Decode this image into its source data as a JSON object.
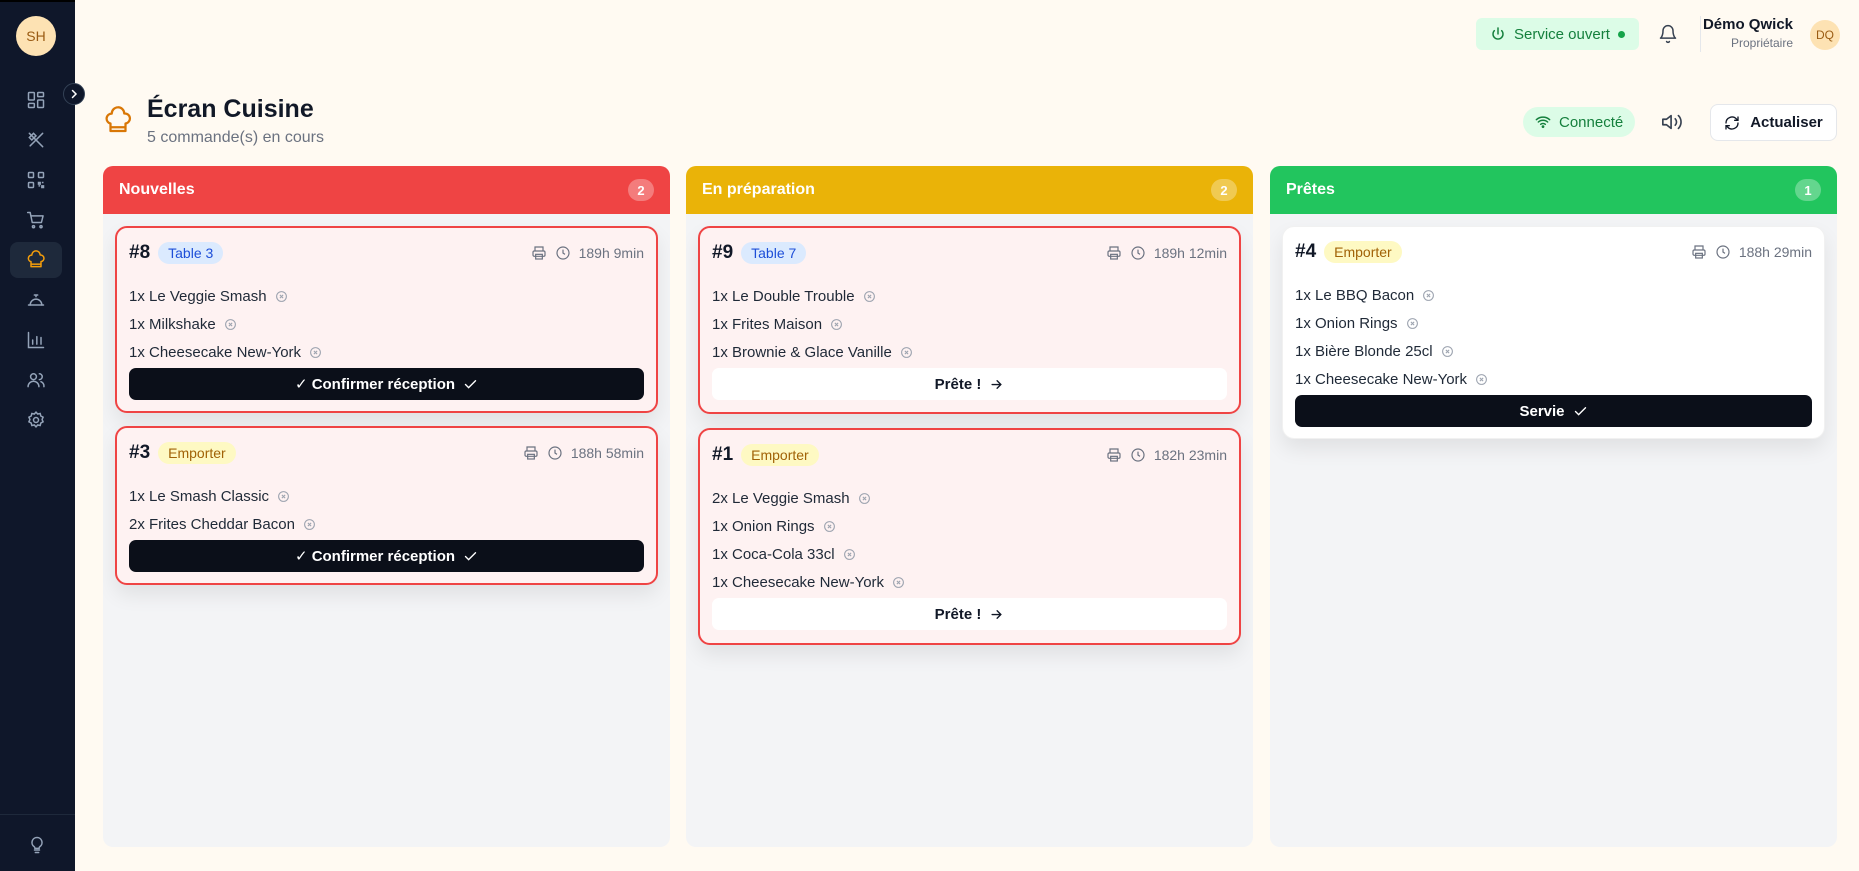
{
  "sidebar": {
    "avatar": "SH",
    "items": [
      {
        "icon": "dashboard-icon",
        "active": false
      },
      {
        "icon": "utensils-icon",
        "active": false
      },
      {
        "icon": "qr-code-icon",
        "active": false
      },
      {
        "icon": "cart-icon",
        "active": false
      },
      {
        "icon": "chef-hat-icon",
        "active": true
      },
      {
        "icon": "service-bell-icon",
        "active": false
      },
      {
        "icon": "bar-chart-icon",
        "active": false
      },
      {
        "icon": "users-icon",
        "active": false
      },
      {
        "icon": "settings-icon",
        "active": false
      }
    ]
  },
  "topbar": {
    "service_status": "Service ouvert",
    "user_name": "Démo Qwick",
    "user_role": "Propriétaire",
    "user_initials": "DQ"
  },
  "header": {
    "title": "Écran Cuisine",
    "subtitle": "5 commande(s) en cours",
    "connection": "Connecté",
    "refresh_label": "Actualiser"
  },
  "columns": {
    "new": {
      "title": "Nouvelles",
      "count": "2",
      "color": "#ef4444",
      "orders": [
        {
          "number": "#8",
          "tag": "Table 3",
          "time": "189h 9min",
          "items": [
            "1x Le Veggie Smash",
            "1x Milkshake",
            "1x Cheesecake New-York"
          ],
          "action": "✓ Confirmer réception"
        },
        {
          "number": "#3",
          "tag": "Emporter",
          "time": "188h 58min",
          "items": [
            "1x Le Smash Classic",
            "2x Frites Cheddar Bacon"
          ],
          "action": "✓ Confirmer réception"
        }
      ]
    },
    "prep": {
      "title": "En préparation",
      "count": "2",
      "color": "#eab308",
      "orders": [
        {
          "number": "#9",
          "tag": "Table 7",
          "time": "189h 12min",
          "items": [
            "1x Le Double Trouble",
            "1x Frites Maison",
            "1x Brownie & Glace Vanille"
          ],
          "action": "Prête !"
        },
        {
          "number": "#1",
          "tag": "Emporter",
          "time": "182h 23min",
          "items": [
            "2x Le Veggie Smash",
            "1x Onion Rings",
            "1x Coca-Cola 33cl",
            "1x Cheesecake New-York"
          ],
          "action": "Prête !"
        }
      ]
    },
    "ready": {
      "title": "Prêtes",
      "count": "1",
      "color": "#22c55e",
      "orders": [
        {
          "number": "#4",
          "tag": "Emporter",
          "time": "188h 29min",
          "items": [
            "1x Le BBQ Bacon",
            "1x Onion Rings",
            "1x Bière Blonde 25cl",
            "1x Cheesecake New-York"
          ],
          "action": "Servie"
        }
      ]
    }
  }
}
